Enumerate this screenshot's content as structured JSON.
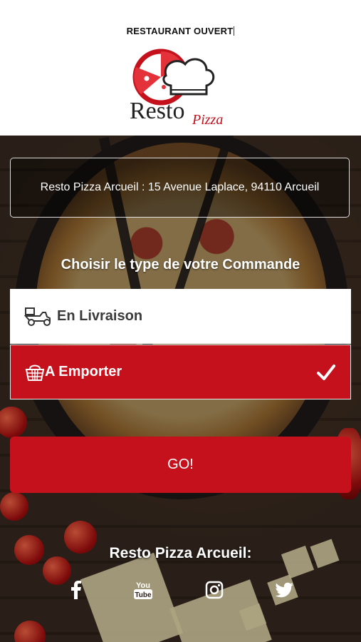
{
  "header": {
    "status_text": "RESTAURANT OUVERT",
    "logo_text": "Resto",
    "logo_subtext": "Pizza"
  },
  "address": {
    "text": "Resto Pizza Arcueil : 15 Avenue Laplace, 94110 Arcueil"
  },
  "order_type": {
    "title": "Choisir le type de votre Commande",
    "options": [
      {
        "label": "En Livraison",
        "icon": "delivery-scooter-icon",
        "selected": false
      },
      {
        "label": "A Emporter",
        "icon": "basket-icon",
        "selected": true
      }
    ]
  },
  "go_button": {
    "label": "GO!"
  },
  "footer": {
    "title": "Resto Pizza Arcueil:",
    "social": [
      {
        "name": "facebook-icon"
      },
      {
        "name": "youtube-icon",
        "text": "You Tube"
      },
      {
        "name": "instagram-icon"
      },
      {
        "name": "twitter-icon"
      }
    ]
  },
  "colors": {
    "accent_red": "#c4111c",
    "white": "#ffffff"
  }
}
